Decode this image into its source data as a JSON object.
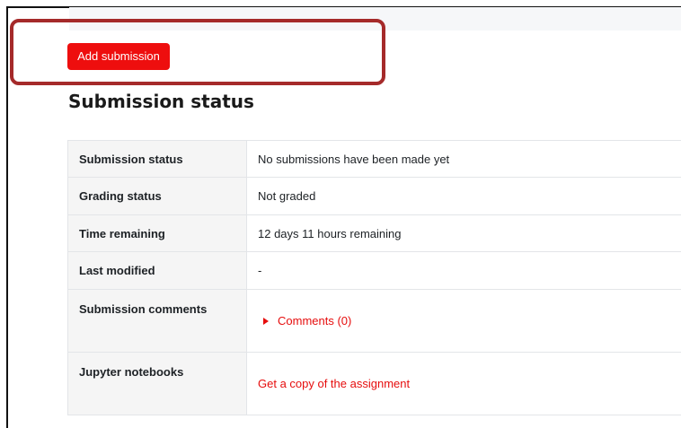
{
  "actions": {
    "add_submission_label": "Add submission"
  },
  "section": {
    "title": "Submission status"
  },
  "status_table": {
    "rows": [
      {
        "key": "Submission status",
        "value": "No submissions have been made yet"
      },
      {
        "key": "Grading status",
        "value": "Not graded"
      },
      {
        "key": "Time remaining",
        "value": "12 days 11 hours remaining"
      },
      {
        "key": "Last modified",
        "value": "-"
      },
      {
        "key": "Submission comments",
        "value": "Comments (0)",
        "icon": "caret-right-icon"
      },
      {
        "key": "Jupyter notebooks",
        "value": "Get a copy of the assignment"
      }
    ]
  },
  "colors": {
    "accent": "#ee0e0e",
    "highlight_border": "#a52a2a",
    "key_cell_bg": "#f5f5f5"
  }
}
